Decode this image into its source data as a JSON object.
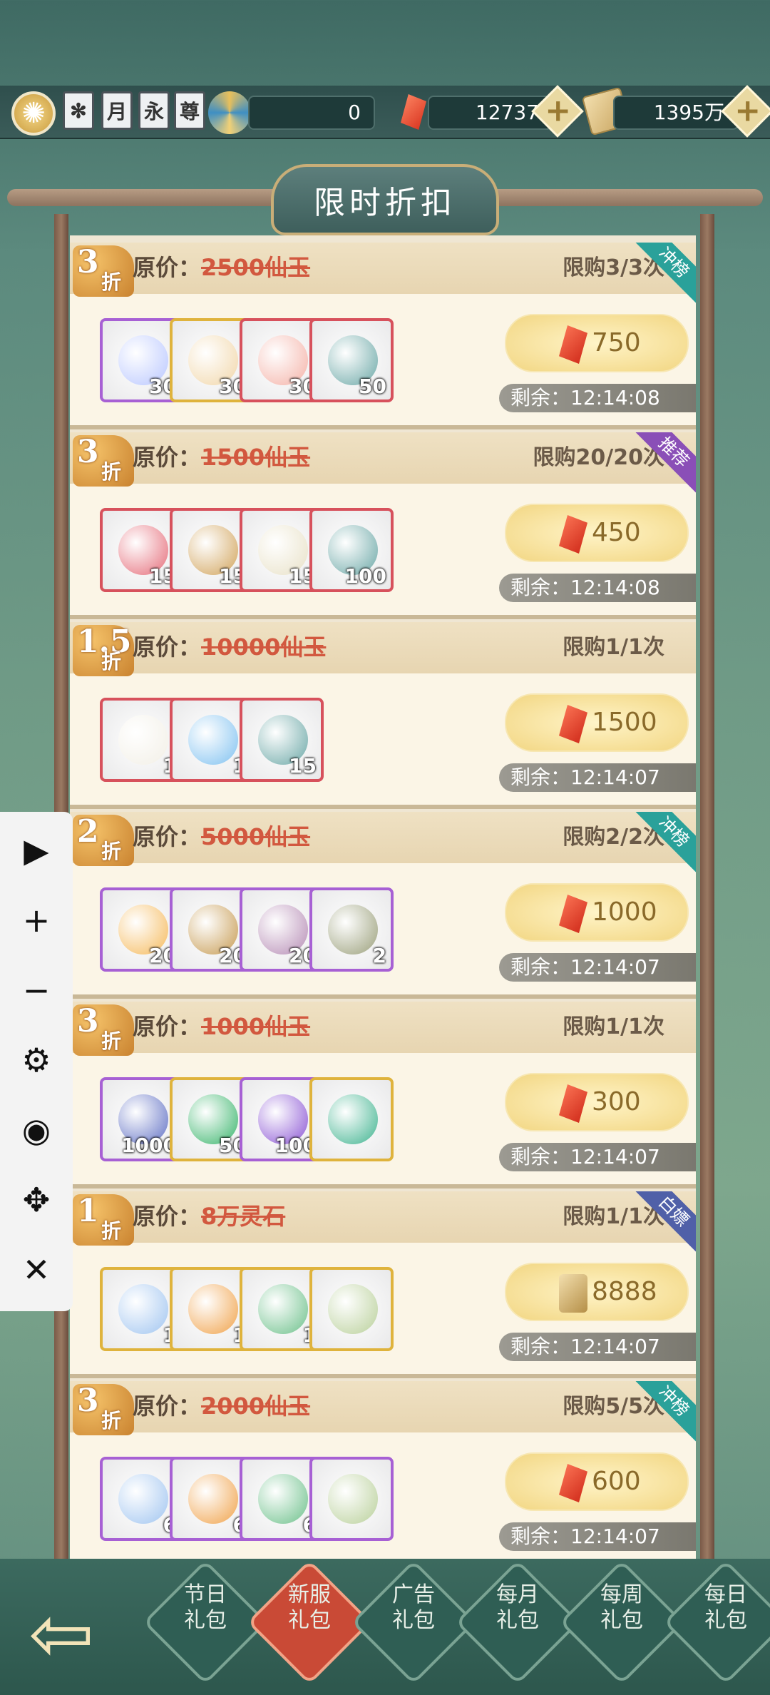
{
  "topbar": {
    "badges": [
      "✻",
      "月",
      "永",
      "尊"
    ],
    "spirit_value": "0",
    "jade_value": "12737",
    "stone_value": "1395万"
  },
  "title": "限时折扣",
  "cards": [
    {
      "disc": "3",
      "zhe": "折",
      "orig_label": "原价：",
      "orig_price": "2500仙玉",
      "limit": "限购3/3次",
      "ribbon": "冲榜",
      "ribbon_color": "#2aa19a",
      "items": [
        {
          "qty": "30",
          "frame": "purple",
          "art": "#b8c6ff"
        },
        {
          "qty": "30",
          "frame": "gold",
          "art": "#f1d6a8"
        },
        {
          "qty": "30",
          "frame": "red",
          "art": "#f4b1a6"
        },
        {
          "qty": "50",
          "frame": "red",
          "art": "#6aa7a6"
        }
      ],
      "price": "750",
      "timer": "剩余：12:14:08"
    },
    {
      "disc": "3",
      "zhe": "折",
      "orig_label": "原价：",
      "orig_price": "1500仙玉",
      "limit": "限购20/20次",
      "ribbon": "推荐",
      "ribbon_color": "#8a4fb7",
      "items": [
        {
          "qty": "15",
          "frame": "red",
          "art": "#e56b78"
        },
        {
          "qty": "15",
          "frame": "red",
          "art": "#d1a35a"
        },
        {
          "qty": "15",
          "frame": "red",
          "art": "#e8e1c7"
        },
        {
          "qty": "100",
          "frame": "red",
          "art": "#6aa7a6"
        }
      ],
      "price": "450",
      "timer": "剩余：12:14:08"
    },
    {
      "disc": "1.5",
      "zhe": "折",
      "orig_label": "原价：",
      "orig_price": "10000仙玉",
      "limit": "限购1/1次",
      "ribbon": "",
      "ribbon_color": "",
      "items": [
        {
          "qty": "1",
          "frame": "red",
          "art": "#f2efe6"
        },
        {
          "qty": "1",
          "frame": "red",
          "art": "#7fc1f0"
        },
        {
          "qty": "15",
          "frame": "red",
          "art": "#6aa7a6"
        }
      ],
      "price": "1500",
      "timer": "剩余：12:14:07"
    },
    {
      "disc": "2",
      "zhe": "折",
      "orig_label": "原价：",
      "orig_price": "5000仙玉",
      "limit": "限购2/2次",
      "ribbon": "冲榜",
      "ribbon_color": "#2aa19a",
      "items": [
        {
          "qty": "20",
          "frame": "purple",
          "art": "#f5b95a"
        },
        {
          "qty": "20",
          "frame": "purple",
          "art": "#c69a50"
        },
        {
          "qty": "20",
          "frame": "purple",
          "art": "#b58bb4"
        },
        {
          "qty": "2",
          "frame": "purple",
          "art": "#9a9f7a"
        }
      ],
      "price": "1000",
      "timer": "剩余：12:14:07"
    },
    {
      "disc": "3",
      "zhe": "折",
      "orig_label": "原价：",
      "orig_price": "1000仙玉",
      "limit": "限购1/1次",
      "ribbon": "",
      "ribbon_color": "",
      "items": [
        {
          "qty": "1000",
          "frame": "purple",
          "art": "#5f6fc4"
        },
        {
          "qty": "50",
          "frame": "gold",
          "art": "#37b46a"
        },
        {
          "qty": "100",
          "frame": "purple",
          "art": "#8a54d4"
        },
        {
          "qty": "",
          "frame": "gold",
          "art": "#3fb38f"
        }
      ],
      "price": "300",
      "timer": "剩余：12:14:07"
    },
    {
      "disc": "1",
      "zhe": "折",
      "orig_label": "原价：",
      "orig_price": "8万灵石",
      "limit": "限购1/1次",
      "ribbon": "白嫖",
      "ribbon_color": "#5060a8",
      "items": [
        {
          "qty": "1",
          "frame": "gold",
          "art": "#9fc4f0"
        },
        {
          "qty": "1",
          "frame": "gold",
          "art": "#f0a24a"
        },
        {
          "qty": "1",
          "frame": "gold",
          "art": "#6cc08a"
        },
        {
          "qty": "",
          "frame": "gold",
          "art": "#b9d09a"
        }
      ],
      "price": "8888",
      "timer": "剩余：12:14:07",
      "price_currency": "stone"
    },
    {
      "disc": "3",
      "zhe": "折",
      "orig_label": "原价：",
      "orig_price": "2000仙玉",
      "limit": "限购5/5次",
      "ribbon": "冲榜",
      "ribbon_color": "#2aa19a",
      "items": [
        {
          "qty": "6",
          "frame": "purple",
          "art": "#9fc4f0"
        },
        {
          "qty": "6",
          "frame": "purple",
          "art": "#f0a24a"
        },
        {
          "qty": "6",
          "frame": "purple",
          "art": "#6cc08a"
        },
        {
          "qty": "",
          "frame": "purple",
          "art": "#b9d09a"
        }
      ],
      "price": "600",
      "timer": "剩余：12:14:07"
    }
  ],
  "sidebar": [
    "▶",
    "+",
    "−",
    "⚙",
    "◉",
    "✥",
    "✕"
  ],
  "tabs": [
    {
      "line1": "节日",
      "line2": "礼包",
      "active": false
    },
    {
      "line1": "新服",
      "line2": "礼包",
      "active": true
    },
    {
      "line1": "广告",
      "line2": "礼包",
      "active": false
    },
    {
      "line1": "每月",
      "line2": "礼包",
      "active": false
    },
    {
      "line1": "每周",
      "line2": "礼包",
      "active": false
    },
    {
      "line1": "每日",
      "line2": "礼包",
      "active": false
    }
  ]
}
